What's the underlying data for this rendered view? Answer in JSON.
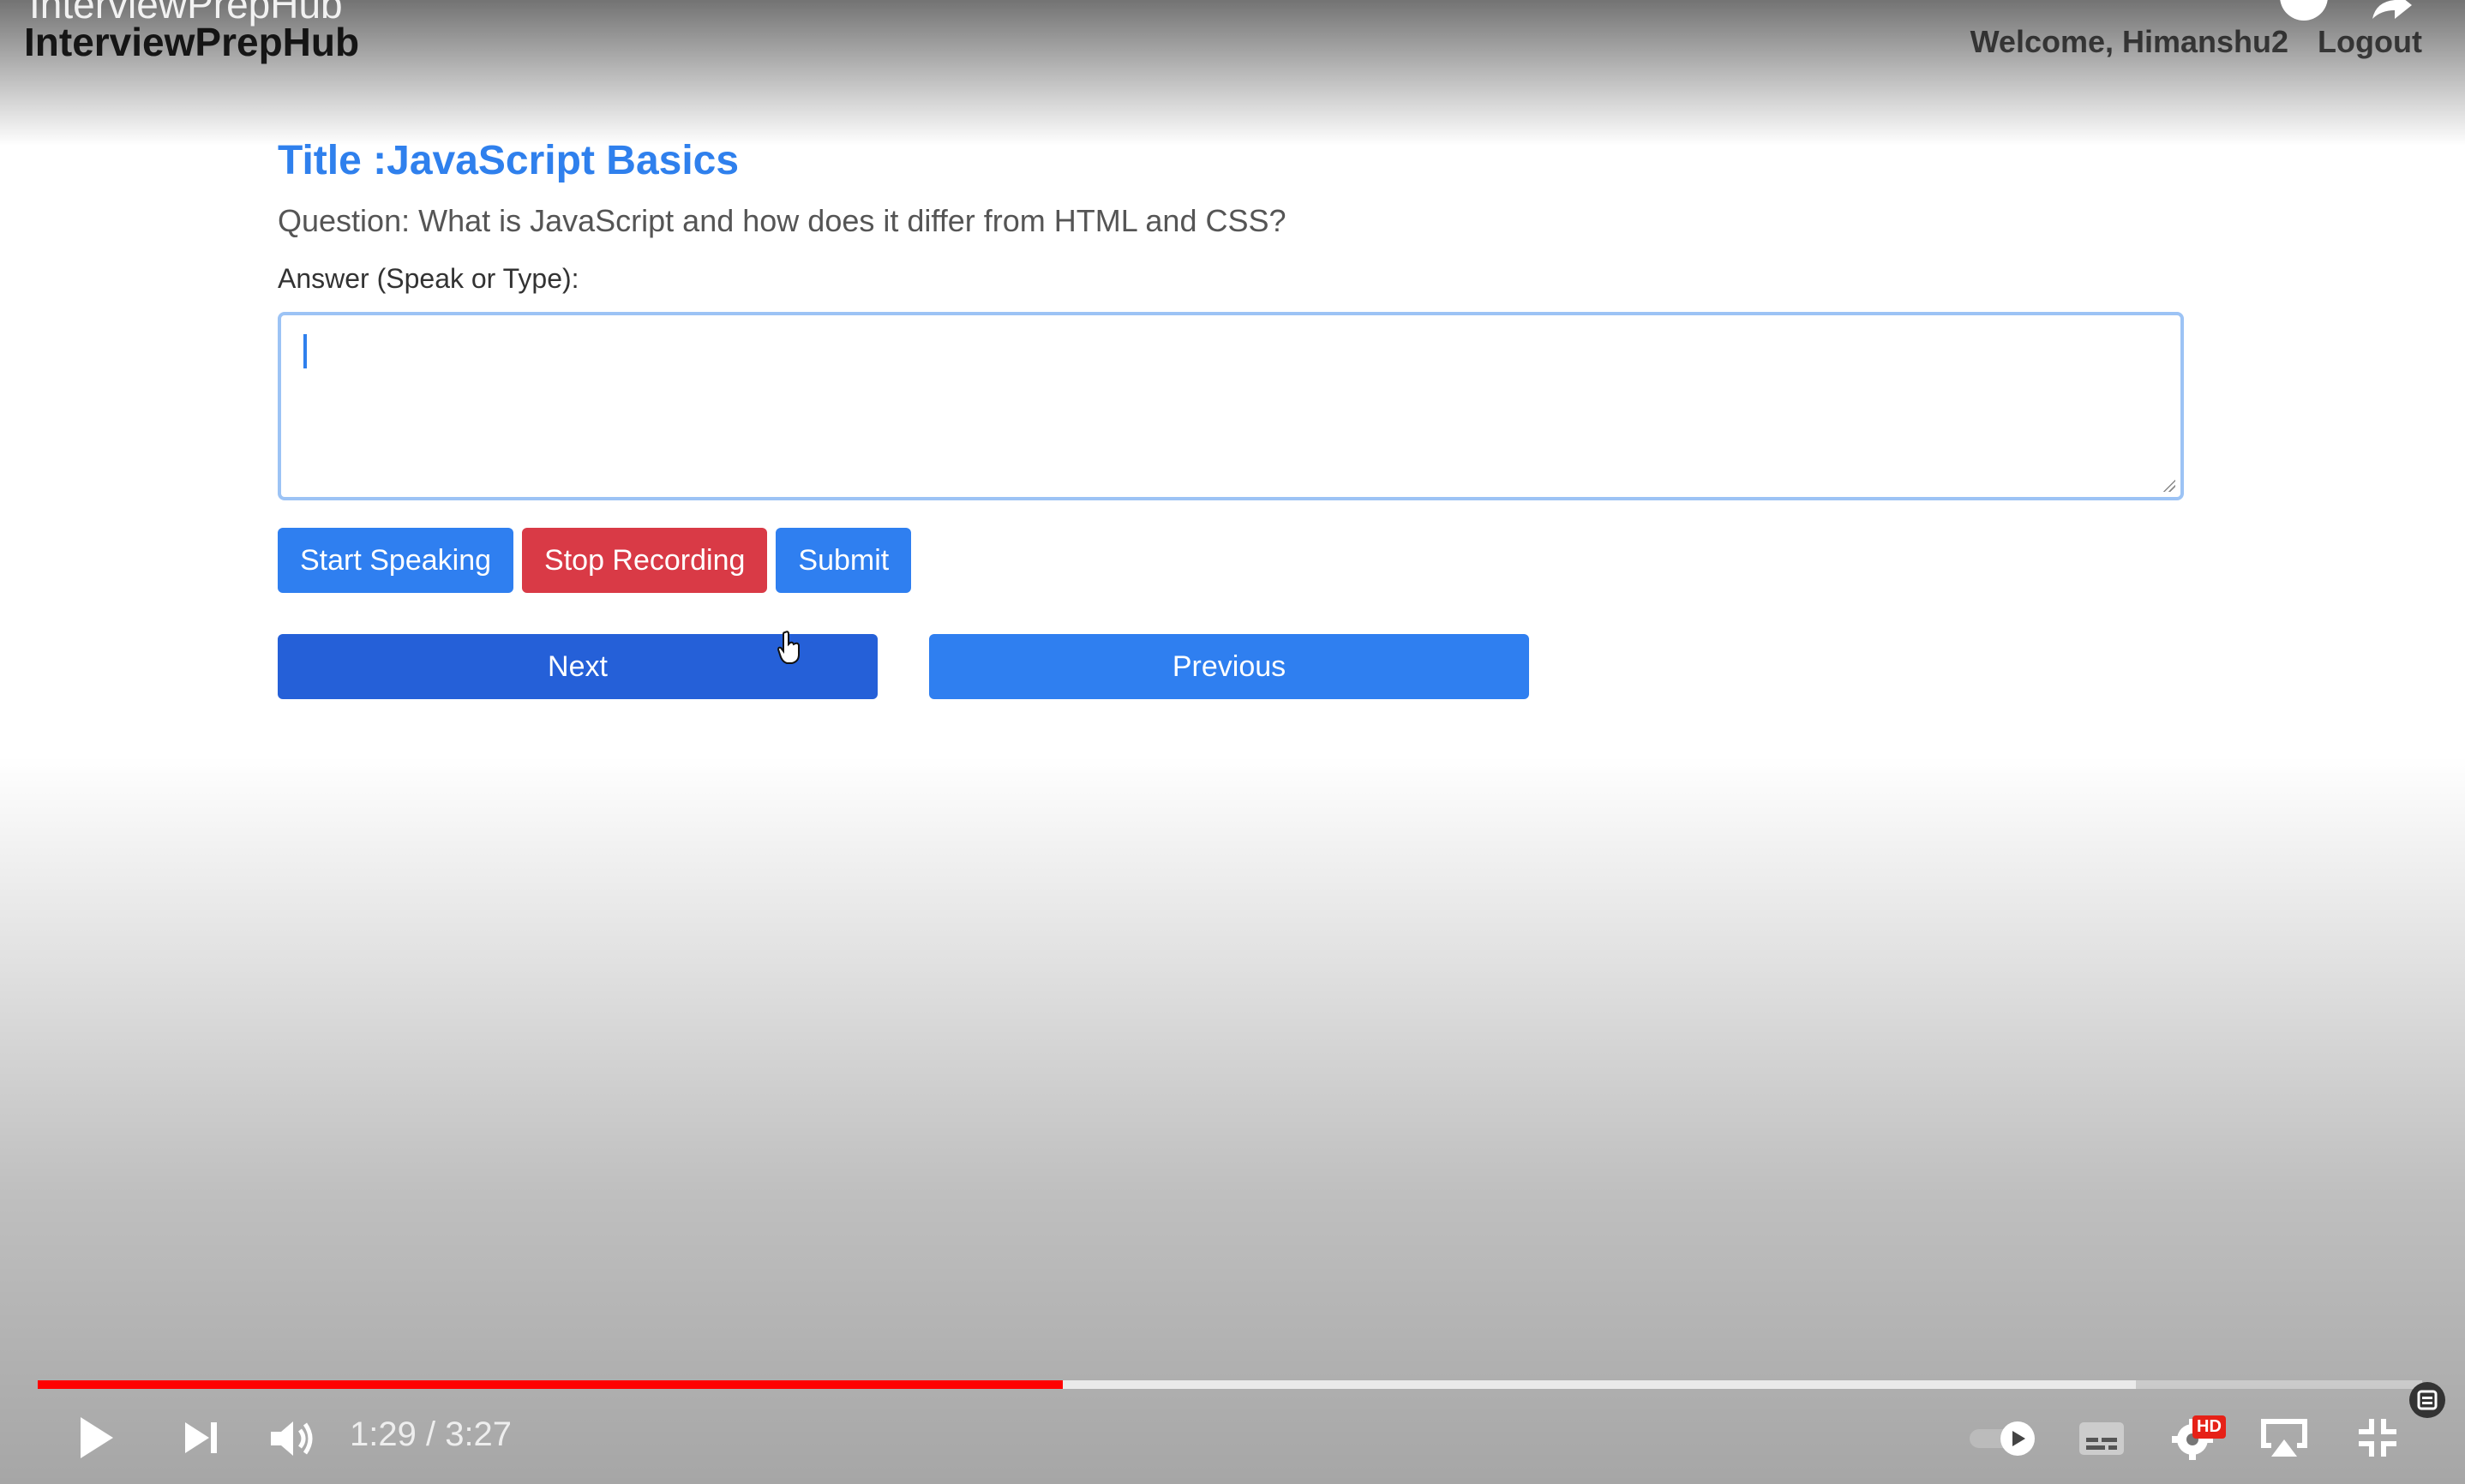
{
  "video_title": "InterviewPrepHub",
  "page": {
    "brand": "InterviewPrepHub",
    "welcome": "Welcome, Himanshu2",
    "logout": "Logout",
    "title": "Title :JavaScript Basics",
    "question": "Question: What is JavaScript and how does it differ from HTML and CSS?",
    "answer_label": "Answer (Speak or Type):",
    "answer_value": "",
    "buttons": {
      "start": "Start Speaking",
      "stop": "Stop Recording",
      "submit": "Submit",
      "next": "Next",
      "previous": "Previous"
    }
  },
  "player": {
    "current_time": "1:29",
    "duration": "3:27",
    "time_display": "1:29 / 3:27",
    "progress_fraction": 0.43,
    "buffered_fraction": 0.88,
    "quality_badge": "HD",
    "icons": [
      "play-icon",
      "next-icon",
      "volume-icon",
      "autoplay-toggle-icon",
      "subtitles-icon",
      "settings-icon",
      "airplay-icon",
      "exit-fullscreen-icon"
    ]
  },
  "colors": {
    "primary_blue": "#2f7ff0",
    "next_blue": "#2560d8",
    "danger_red": "#d93a46",
    "title_blue": "#2f80ed",
    "progress_red": "#ff0000"
  }
}
